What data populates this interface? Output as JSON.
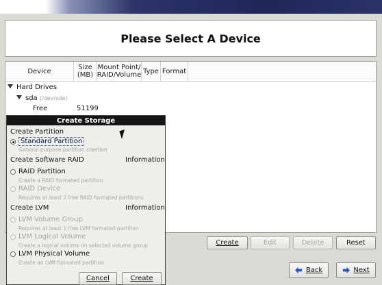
{
  "header": {
    "title": "Please Select A Device"
  },
  "tree": {
    "columns": [
      "Device",
      "Size\n(MB)",
      "Mount Point/\nRAID/Volume",
      "Type",
      "Format"
    ],
    "group_label": "Hard Drives",
    "disk_label": "sda",
    "disk_path": "(/dev/sda)",
    "free_label": "Free",
    "free_size": "51199"
  },
  "actions": {
    "create": "Create",
    "edit": "Edit",
    "delete": "Delete",
    "reset": "Reset"
  },
  "nav": {
    "back": "Back",
    "next": "Next"
  },
  "dialog": {
    "title": "Create Storage",
    "section_partition": "Create Partition",
    "standard_partition": "Standard Partition",
    "standard_desc": "General purpose partition creation",
    "section_raid": "Create Software RAID",
    "info_label": "Information",
    "raid_partition": "RAID Partition",
    "raid_partition_desc": "Create a RAID formated partition",
    "raid_device": "RAID Device",
    "raid_device_desc": "Requires at least 2 free RAID formated partitions",
    "section_lvm": "Create LVM",
    "lvm_group": "LVM Volume Group",
    "lvm_group_desc": "Requires at least 1 free LVM formated partition",
    "lvm_logical": "LVM Logical Volume",
    "lvm_logical_desc": "Create a logical volume on selected volume group",
    "lvm_physical": "LVM Physical Volume",
    "lvm_physical_desc": "Create an LVM formated partition",
    "cancel": "Cancel",
    "create": "Create"
  },
  "colors": {
    "banner": "#1f2759",
    "dialog_title_bg": "#151515",
    "arrow_blue": "#2b56c6"
  }
}
